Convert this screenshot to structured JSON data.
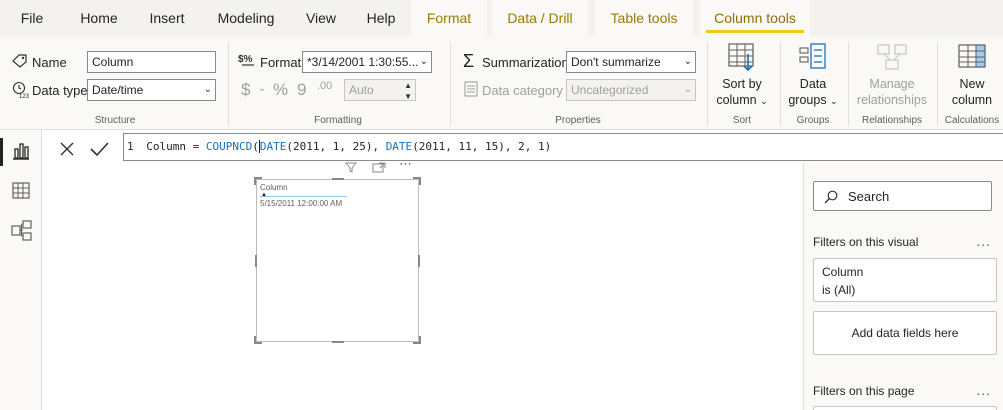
{
  "menu": {
    "items": [
      "File",
      "Home",
      "Insert",
      "Modeling",
      "View",
      "Help",
      "Format",
      "Data / Drill",
      "Table tools",
      "Column tools"
    ],
    "active": "Column tools"
  },
  "ribbon": {
    "structure": {
      "name_label": "Name",
      "name_value": "Column",
      "datatype_label": "Data type",
      "datatype_value": "Date/time",
      "group_label": "Structure"
    },
    "formatting": {
      "format_label": "Format",
      "format_value": "*3/14/2001 1:30:55...",
      "currency_symbol": "$",
      "percent_symbol": "%",
      "comma_symbol": "9",
      "decimal_symbol": ".00",
      "auto_value": "Auto",
      "group_label": "Formatting"
    },
    "properties": {
      "summarization_label": "Summarization",
      "summarization_value": "Don't summarize",
      "category_label": "Data category",
      "category_value": "Uncategorized",
      "group_label": "Properties"
    },
    "sort": {
      "button_line1": "Sort by",
      "button_line2": "column",
      "group_label": "Sort"
    },
    "groups": {
      "button_line1": "Data",
      "button_line2": "groups",
      "group_label": "Groups"
    },
    "relationships": {
      "button_line1": "Manage",
      "button_line2": "relationships",
      "group_label": "Relationships"
    },
    "calculations": {
      "button_line1": "New",
      "button_line2": "column",
      "group_label": "Calculations"
    }
  },
  "formula": {
    "line_number": "1",
    "prefix": "Column = ",
    "fn_outer": "COUPNCD",
    "fn_date": "DATE",
    "args1": "(2011, 1, 25), ",
    "args2": "(2011, 11, 15), 2, 1)",
    "open_paren": "("
  },
  "visual": {
    "header": "Column",
    "value": "5/15/2011 12:00:00 AM"
  },
  "filters": {
    "search_placeholder": "Search",
    "on_visual_title": "Filters on this visual",
    "card_field": "Column",
    "card_state": "is (All)",
    "add_fields": "Add data fields here",
    "on_page_title": "Filters on this page",
    "more": "..."
  },
  "colors": {
    "accent_yellow": "#f2c811",
    "context_tab_text": "#9c7a00",
    "dax_function": "#1a6fb8"
  }
}
